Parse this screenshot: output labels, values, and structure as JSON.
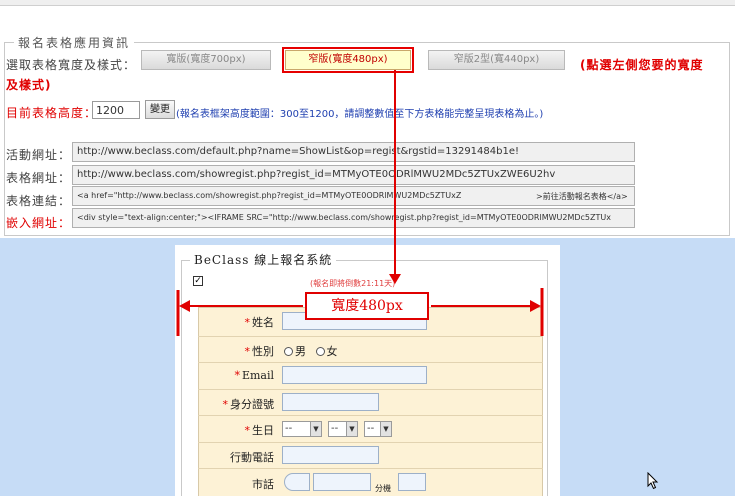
{
  "settings": {
    "legend": "報名表格應用資訊",
    "width_label": "選取表格寬度及樣式：",
    "width_buttons": [
      {
        "label": "寬版(寬度700px)",
        "selected": false
      },
      {
        "label": "窄版(寬度480px)",
        "selected": true
      },
      {
        "label": "窄版2型(寬440px)",
        "selected": false
      }
    ],
    "hint_line1": "(點選左側您要的寬度",
    "hint_line2": "及樣式)",
    "height_label": "目前表格高度：",
    "height_value": "1200",
    "change_button": "變更",
    "height_range": "(報名表框架高度範圍：300至1200，請調整數值至下方表格能完整呈現表格為止。)",
    "activity_url_label": "活動網址：",
    "activity_url": "http://www.beclass.com/default.php?name=ShowList&op=regist&rgstid=13291484b1e!",
    "form_url_label": "表格網址：",
    "form_url": "http://www.beclass.com/showregist.php?regist_id=MTMyOTE0ODRlMWU2MDc5ZTUxZWE6U2hv",
    "form_link_label": "表格連結：",
    "form_link": "<a href=\"http://www.beclass.com/showregist.php?regist_id=MTMyOTE0ODRlMWU2MDc5ZTUxZ",
    "form_link_tail": ">前往活動報名表格</a>",
    "embed_url_label": "嵌入網址：",
    "embed_url": "<div style=\"text-align:center;\"><IFRAME SRC=\"http://www.beclass.com/showregist.php?regist_id=MTMyOTE0ODRlMWU2MDc5ZTUx"
  },
  "preview": {
    "legend": "BeClass 線上報名系統",
    "checkbox_mark": "✓",
    "deadline": "(報名即將倒數21:11天)",
    "width_annotation": "寬度480px",
    "fields": {
      "name": "姓名",
      "gender": "性別",
      "male": "男",
      "female": "女",
      "email": "Email",
      "id_number": "身分證號",
      "birthday": "生日",
      "birthday_placeholder": "--",
      "mobile": "行動電話",
      "phone": "市話",
      "extension": "分機"
    }
  },
  "colors": {
    "accent_red": "#e00000",
    "preview_bg": "#c6dcf6",
    "form_bg": "#fdf2d6"
  }
}
